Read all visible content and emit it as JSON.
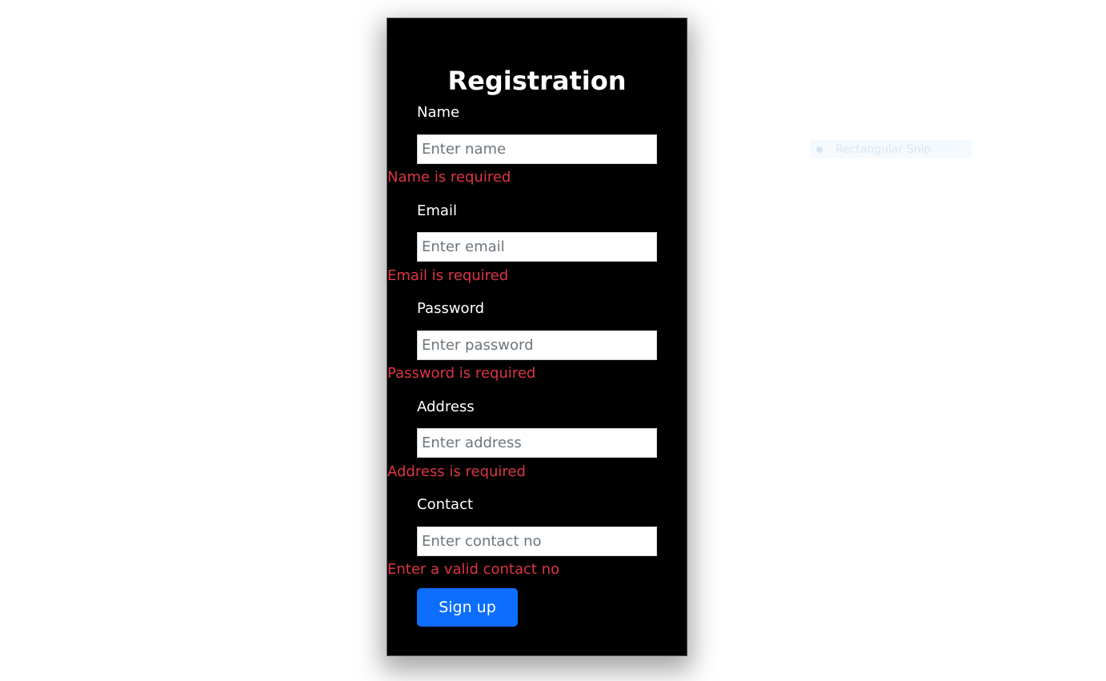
{
  "form": {
    "title": "Registration",
    "fields": [
      {
        "label": "Name",
        "placeholder": "Enter name",
        "value": "",
        "error": "Name is required"
      },
      {
        "label": "Email",
        "placeholder": "Enter email",
        "value": "",
        "error": "Email is required"
      },
      {
        "label": "Password",
        "placeholder": "Enter password",
        "value": "",
        "error": "Password is required"
      },
      {
        "label": "Address",
        "placeholder": "Enter address",
        "value": "",
        "error": "Address is required"
      },
      {
        "label": "Contact",
        "placeholder": "Enter contact no",
        "value": "",
        "error": "Enter a valid contact no"
      }
    ],
    "submit_label": "Sign up"
  },
  "overlay": {
    "snip_label": "Rectangular Snip",
    "snip_icon": "dot-icon"
  },
  "colors": {
    "card_background": "#000000",
    "error": "#dc3545",
    "button": "#0d6efd"
  }
}
